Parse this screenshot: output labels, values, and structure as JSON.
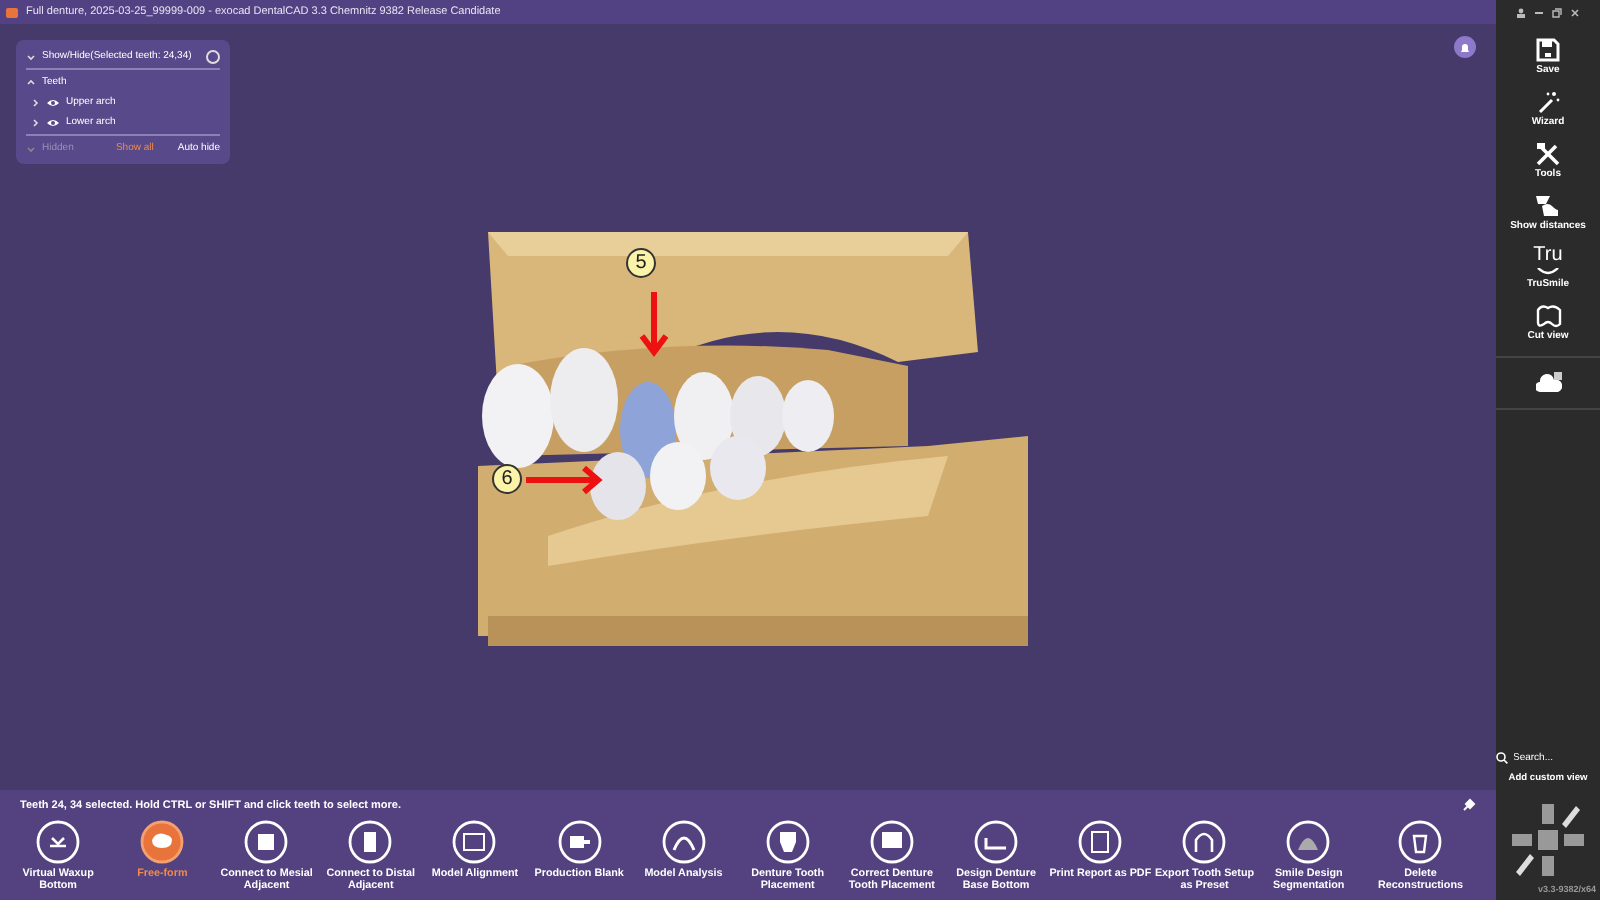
{
  "title_bar": {
    "title": "Full denture, 2025-03-25_99999-009 - exocad DentalCAD 3.3 Chemnitz 9382 Release Candidate"
  },
  "visibility_panel": {
    "title": "Show/Hide(Selected teeth: 24,34)",
    "expanded": true,
    "group": {
      "label": "Teeth",
      "expanded": true,
      "children": [
        {
          "label": "Upper arch",
          "expanded": false,
          "visible": true
        },
        {
          "label": "Lower arch",
          "expanded": false,
          "visible": true
        }
      ]
    },
    "hidden_label": "Hidden",
    "show_all": "Show all",
    "auto_hide": "Auto hide"
  },
  "viewport": {
    "callouts": [
      {
        "label": "5"
      },
      {
        "label": "6"
      }
    ]
  },
  "status": "Teeth 24, 34 selected. Hold CTRL or SHIFT and click teeth to select more.",
  "tools": [
    {
      "label": "Virtual Waxup Bottom",
      "selected": false
    },
    {
      "label": "Free-form",
      "selected": true
    },
    {
      "label": "Connect to Mesial Adjacent",
      "selected": false
    },
    {
      "label": "Connect to Distal Adjacent",
      "selected": false
    },
    {
      "label": "Model Alignment",
      "selected": false
    },
    {
      "label": "Production Blank",
      "selected": false
    },
    {
      "label": "Model Analysis",
      "selected": false
    },
    {
      "label": "Denture Tooth Placement",
      "selected": false
    },
    {
      "label": "Correct Denture Tooth Placement",
      "selected": false
    },
    {
      "label": "Design Denture Base Bottom",
      "selected": false
    },
    {
      "label": "Print Report as PDF",
      "selected": false
    },
    {
      "label": "Export Tooth Setup as Preset",
      "selected": false
    },
    {
      "label": "Smile Design Segmentation",
      "selected": false
    },
    {
      "label": "Delete Reconstructions",
      "selected": false
    }
  ],
  "sidebar": {
    "items": [
      {
        "kind": "save",
        "label": "Save"
      },
      {
        "kind": "wizard",
        "label": "Wizard"
      },
      {
        "kind": "tools",
        "label": "Tools"
      },
      {
        "kind": "distances",
        "label": "Show distances"
      },
      {
        "kind": "trusmile",
        "glyph": "Tru",
        "label": "TruSmile"
      },
      {
        "kind": "cut",
        "label": "Cut view"
      },
      {
        "kind": "cloud"
      }
    ],
    "search": {
      "placeholder": "Search..."
    },
    "add_view": "Add custom view",
    "version": "v3.3-9382/x64"
  }
}
